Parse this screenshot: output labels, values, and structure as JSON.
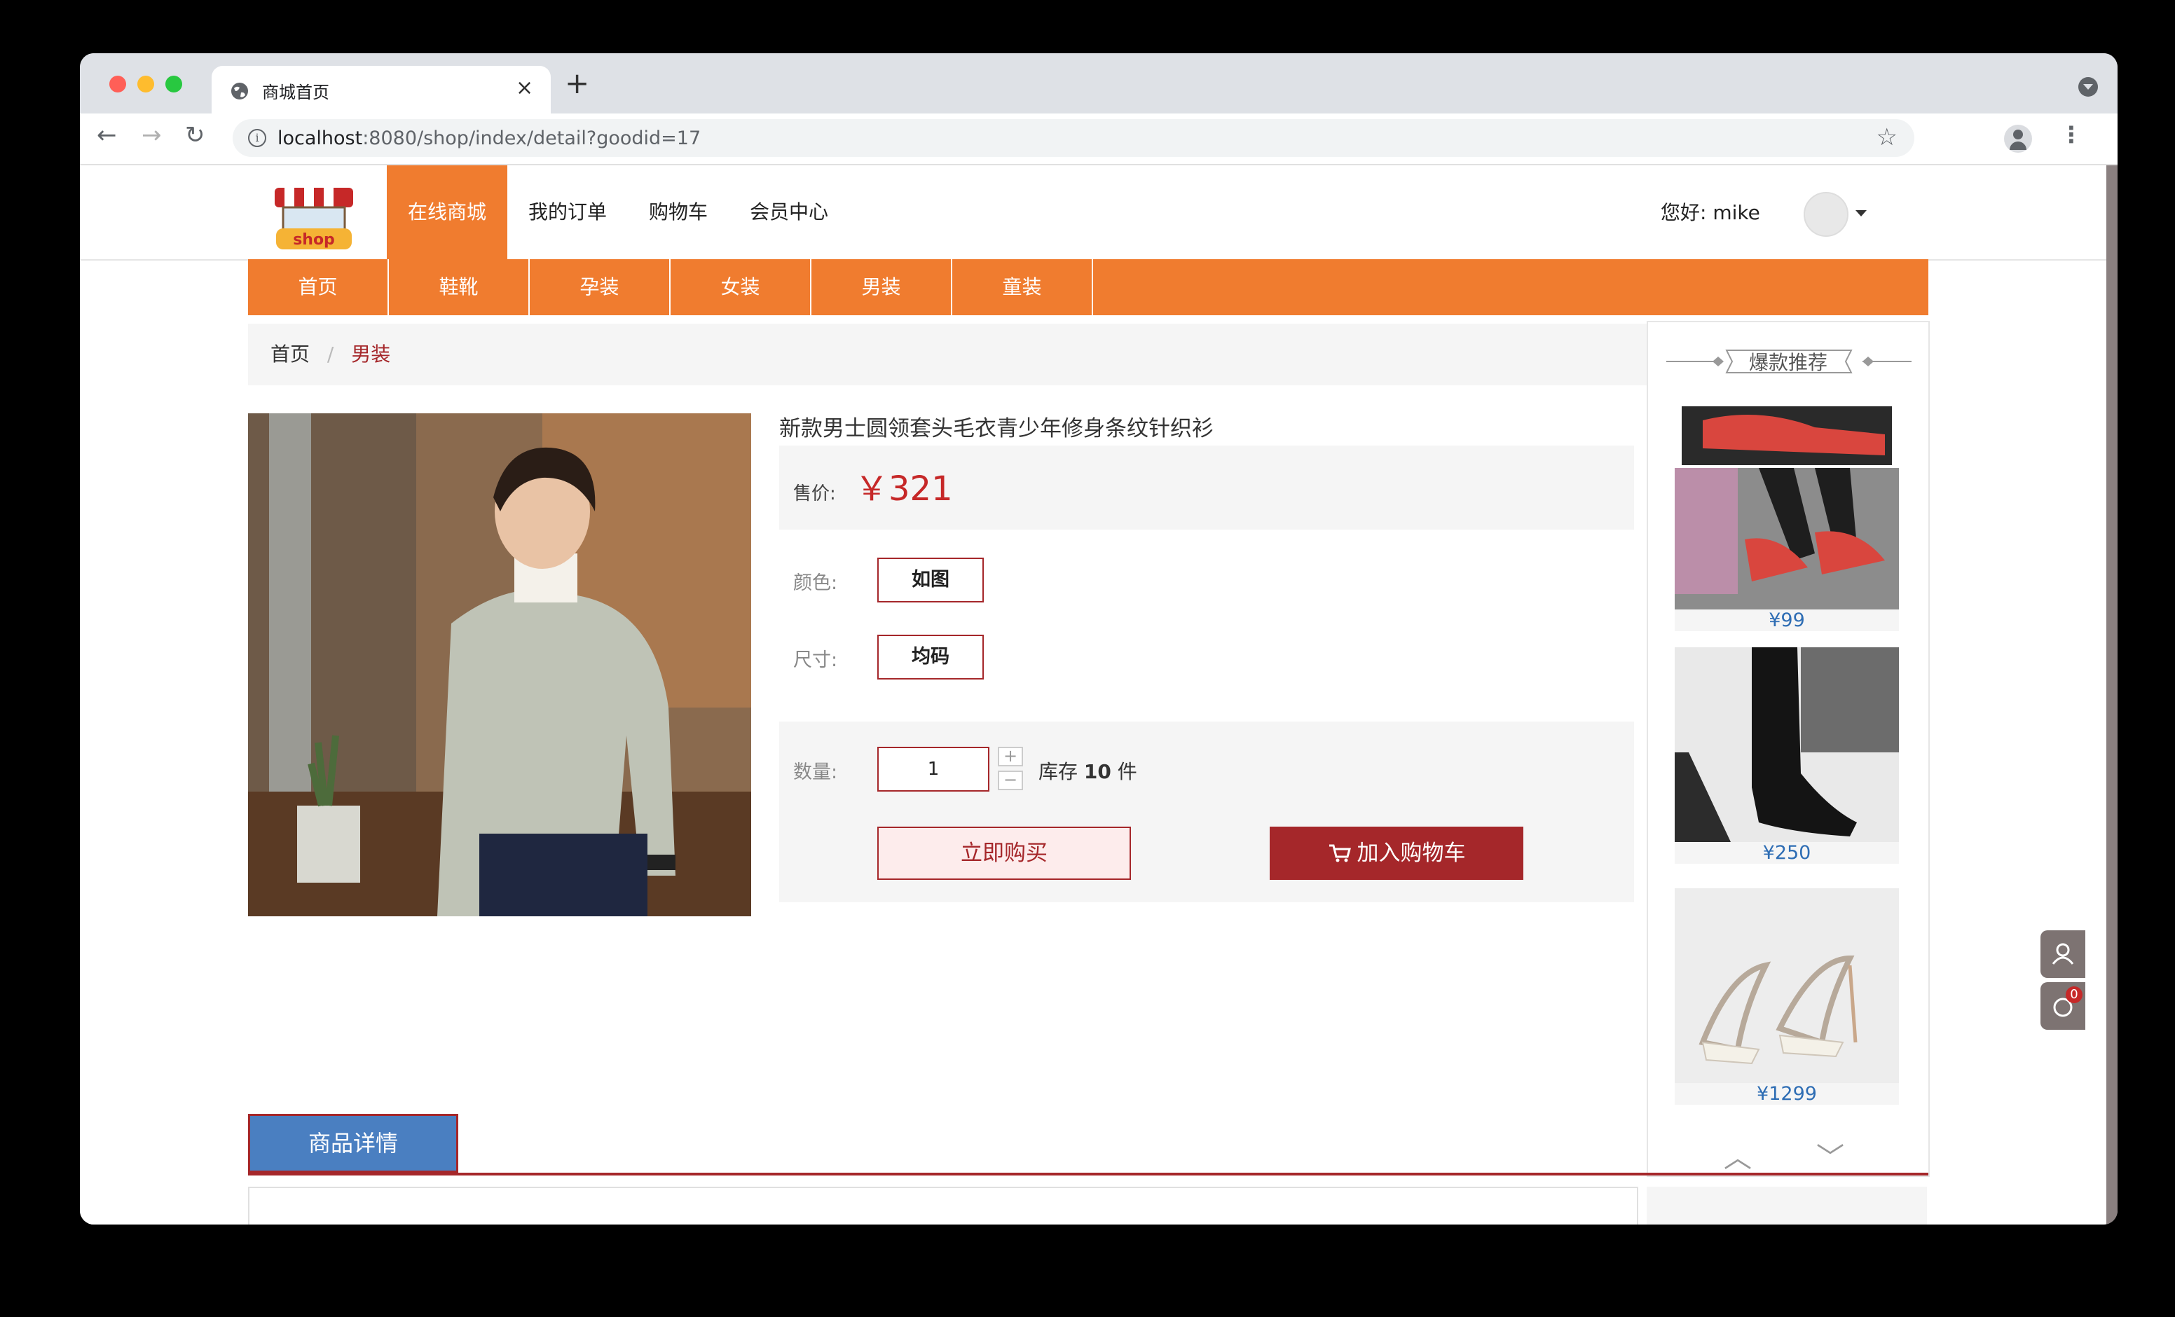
{
  "browser": {
    "tab_title": "商城首页",
    "url_host": "localhost",
    "url_rest": ":8080/shop/index/detail?goodid=17"
  },
  "header": {
    "logo_text": "shop",
    "nav": [
      "在线商城",
      "我的订单",
      "购物车",
      "会员中心"
    ],
    "active_nav": "在线商城",
    "greeting": "您好: mike"
  },
  "categories": [
    "首页",
    "鞋靴",
    "孕装",
    "女装",
    "男装",
    "童装"
  ],
  "breadcrumb": {
    "home": "首页",
    "separator": "/",
    "current": "男装"
  },
  "product": {
    "title": "新款男士圆领套头毛衣青少年修身条纹针织衫",
    "price_label": "售价:",
    "price": "￥321",
    "color_label": "颜色:",
    "color_value": "如图",
    "size_label": "尺寸:",
    "size_value": "均码",
    "qty_label": "数量:",
    "qty": "1",
    "stock_prefix": "库存",
    "stock_count": "10",
    "stock_unit": "件",
    "buy_now": "立即购买",
    "add_cart": "加入购物车"
  },
  "sidebar": {
    "title": "爆款推荐",
    "items": [
      {
        "price": "¥99",
        "image": "red-sneakers"
      },
      {
        "price": "¥250",
        "image": "black-boot"
      },
      {
        "price": "¥1299",
        "image": "white-heel-sandal"
      }
    ]
  },
  "detail_tab": "商品详情",
  "float_badge": "0",
  "colors": {
    "accent_orange": "#f07c2f",
    "dark_red": "#a5272a",
    "price_red": "#c62828",
    "link_blue": "#2e6db4",
    "tab_blue": "#4a7fc1"
  }
}
